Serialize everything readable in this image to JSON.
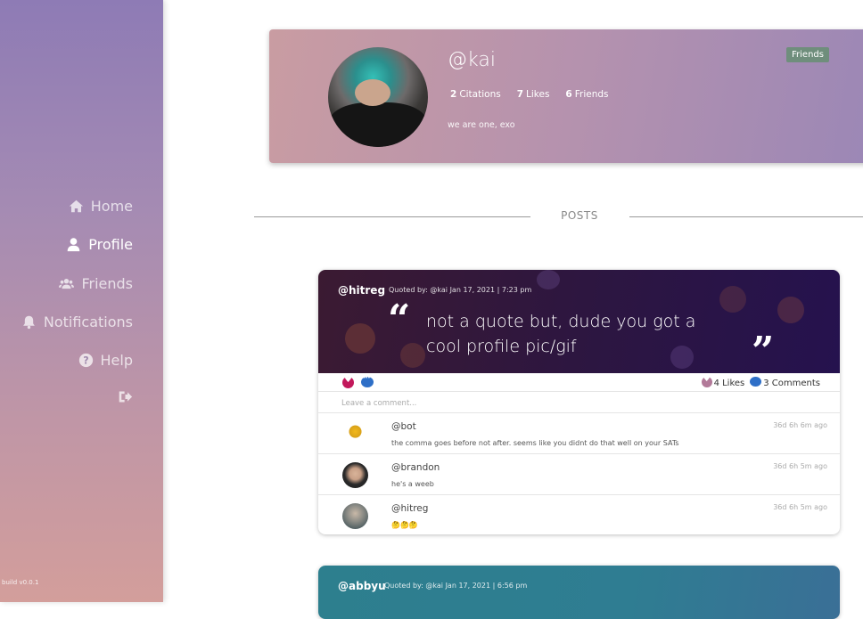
{
  "sidebar": {
    "items": [
      {
        "label": "Home",
        "icon": "home-icon",
        "active": false
      },
      {
        "label": "Profile",
        "icon": "user-icon",
        "active": true
      },
      {
        "label": "Friends",
        "icon": "users-icon",
        "active": false
      },
      {
        "label": "Notifications",
        "icon": "bell-icon",
        "active": false
      },
      {
        "label": "Help",
        "icon": "question-circle-icon",
        "active": false
      }
    ],
    "logout_icon": "sign-out-icon",
    "build": "build v0.0.1"
  },
  "profile": {
    "handle": "@kai",
    "citations_count": "2",
    "citations_label": "Citations",
    "likes_count": "7",
    "likes_label": "Likes",
    "friends_count": "6",
    "friends_label": "Friends",
    "bio": "we are one, exo",
    "badge": "Friends"
  },
  "section_title": "POSTS",
  "posts": [
    {
      "user": "@hitreg",
      "meta": "Quoted by: @kai   Jan 17, 2021 | 7:23 pm",
      "quote": "not a quote but, dude you got a cool profile pic/gif",
      "likes": "4 Likes",
      "comments_count": "3 Comments",
      "comment_placeholder": "Leave a comment...",
      "comments": [
        {
          "user": "@bot",
          "text": "the comma goes before not after. seems like you didnt do that well on your SATs",
          "time": "36d 6h 6m ago"
        },
        {
          "user": "@brandon",
          "text": "he's a weeb",
          "time": "36d 6h 5m ago"
        },
        {
          "user": "@hitreg",
          "text": "🤔🤔🤔",
          "time": "36d 6h 5m ago"
        }
      ]
    },
    {
      "user": "@abbyu",
      "meta": "Quoted by: @kai   Jan 17, 2021 | 6:56 pm"
    }
  ],
  "colors": {
    "badge_green": "#6f8e7c",
    "like_pink": "#c2185b",
    "comment_blue": "#2e6fc7"
  }
}
